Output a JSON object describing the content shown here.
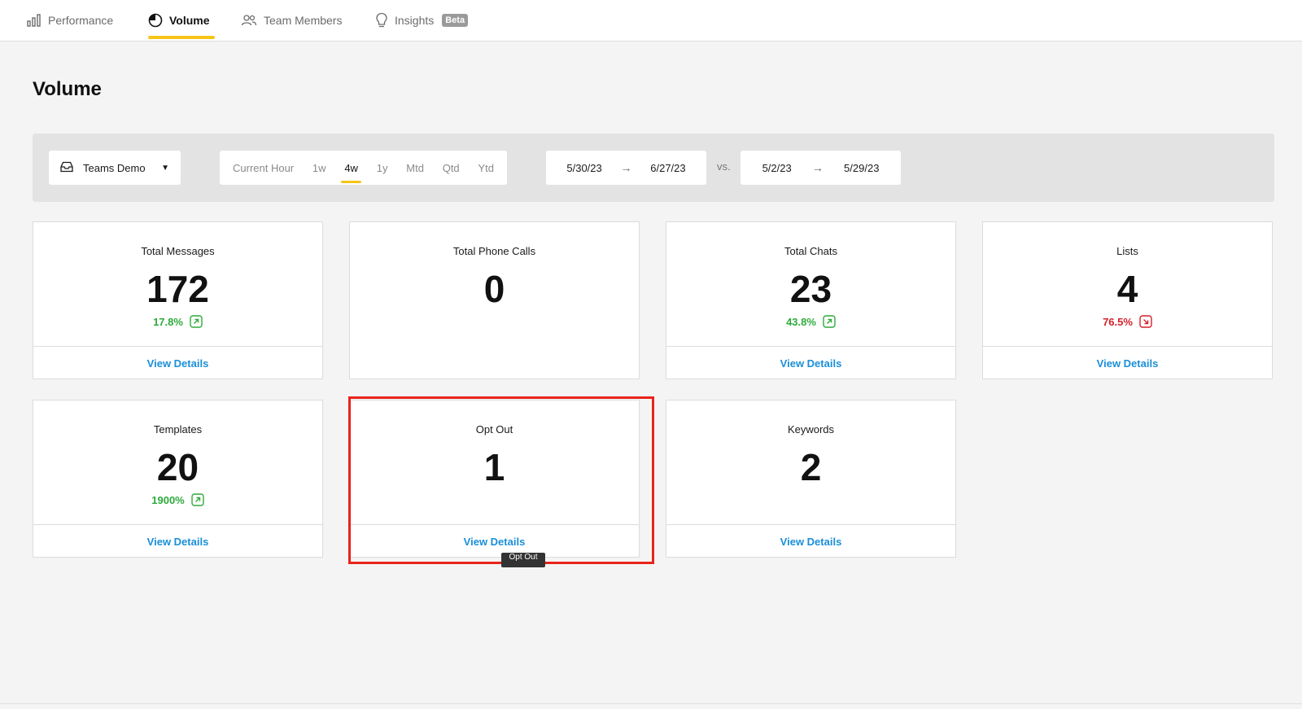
{
  "tabs": [
    {
      "label": "Performance",
      "icon": "bar-chart-icon"
    },
    {
      "label": "Volume",
      "icon": "pie-chart-icon"
    },
    {
      "label": "Team Members",
      "icon": "users-icon"
    },
    {
      "label": "Insights",
      "icon": "lightbulb-icon",
      "badge": "Beta"
    }
  ],
  "active_tab": "Volume",
  "page_title": "Volume",
  "filters": {
    "team": "Teams Demo",
    "periods": [
      "Current Hour",
      "1w",
      "4w",
      "1y",
      "Mtd",
      "Qtd",
      "Ytd"
    ],
    "active_period": "4w",
    "range_start": "5/30/23",
    "range_end": "6/27/23",
    "vs_label": "vs.",
    "compare_start": "5/2/23",
    "compare_end": "5/29/23"
  },
  "cards": [
    {
      "label": "Total Messages",
      "value": "172",
      "change": "17.8%",
      "trend": "up",
      "link": "View Details"
    },
    {
      "label": "Total Phone Calls",
      "value": "0"
    },
    {
      "label": "Total Chats",
      "value": "23",
      "change": "43.8%",
      "trend": "up",
      "link": "View Details"
    },
    {
      "label": "Lists",
      "value": "4",
      "change": "76.5%",
      "trend": "down",
      "link": "View Details"
    },
    {
      "label": "Templates",
      "value": "20",
      "change": "1900%",
      "trend": "up",
      "link": "View Details"
    },
    {
      "label": "Opt Out",
      "value": "1",
      "link": "View Details"
    },
    {
      "label": "Keywords",
      "value": "2",
      "link": "View Details"
    }
  ],
  "tooltip": "Opt Out",
  "colors": {
    "accent": "#f5c518",
    "link": "#1a8fd8",
    "up": "#2eaa3c",
    "down": "#d4202a",
    "highlight": "#e8231a"
  }
}
